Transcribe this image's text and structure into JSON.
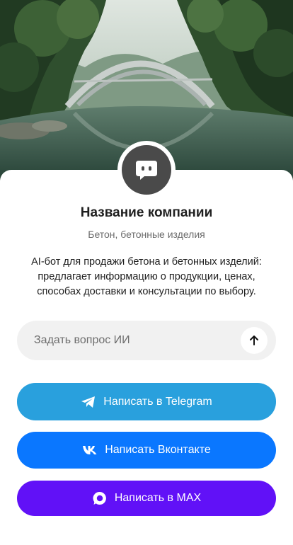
{
  "hero": {
    "image": "forest-river-bridge-photo"
  },
  "colors": {
    "telegram": "#29a0dd",
    "vk": "#0a77ff",
    "max": "#6111f7",
    "avatar": "#4a4a4a",
    "input_bg": "#f1f1f1"
  },
  "company": {
    "avatar_icon": "chat-bot-icon",
    "name": "Название компании",
    "subtitle": "Бетон, бетонные изделия",
    "description": "AI-бот для продажи бетона и бетонных изделий: предлагает информацию о продукции, ценах, способах доставки и консультации по выбору."
  },
  "ask": {
    "placeholder": "Задать вопрос ИИ",
    "value": "",
    "send_icon": "arrow-up-icon"
  },
  "actions": {
    "telegram": {
      "label": "Написать в Telegram",
      "icon": "telegram-icon"
    },
    "vk": {
      "label": "Написать Вконтакте",
      "icon": "vk-icon"
    },
    "max": {
      "label": "Написать в MAX",
      "icon": "max-icon"
    }
  }
}
